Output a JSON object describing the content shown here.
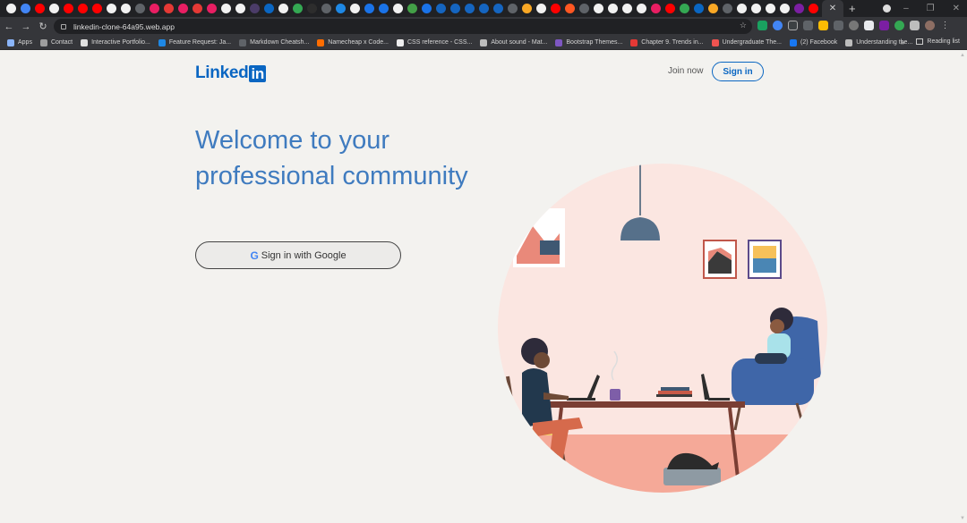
{
  "browser": {
    "url": "linkedin-clone-64a95.web.app",
    "bookmarks": [
      {
        "label": "Apps",
        "color": "#8ab4f8"
      },
      {
        "label": "Contact",
        "color": "#9e9e9e"
      },
      {
        "label": "Interactive Portfolio...",
        "color": "#e0e0e0"
      },
      {
        "label": "Feature Request: Ja...",
        "color": "#1e88e5"
      },
      {
        "label": "Markdown Cheatsh...",
        "color": "#5f6368"
      },
      {
        "label": "Namecheap x Code...",
        "color": "#ff6d00"
      },
      {
        "label": "CSS reference - CSS...",
        "color": "#eeeeee"
      },
      {
        "label": "About sound - Mat...",
        "color": "#bdbdbd"
      },
      {
        "label": "Bootstrap Themes...",
        "color": "#7e57c2"
      },
      {
        "label": "Chapter 9. Trends in...",
        "color": "#e53935"
      },
      {
        "label": "Undergraduate The...",
        "color": "#ef5350"
      },
      {
        "label": "(2) Facebook",
        "color": "#1877f2"
      },
      {
        "label": "Understanding the...",
        "color": "#bdbdbd"
      }
    ],
    "bookmarks_more": "»",
    "reading_list": "Reading list"
  },
  "header": {
    "logo_text": "Linked",
    "logo_badge": "in",
    "join_now": "Join now",
    "sign_in": "Sign in"
  },
  "hero": {
    "headline": "Welcome to your professional community",
    "google_button": "Sign in with Google",
    "google_glyph": "G"
  },
  "colors": {
    "brand": "#0a66c2",
    "headline": "#3f7bbf",
    "illustration_circle": "#fbe6e1",
    "floor": "#f5a998"
  }
}
